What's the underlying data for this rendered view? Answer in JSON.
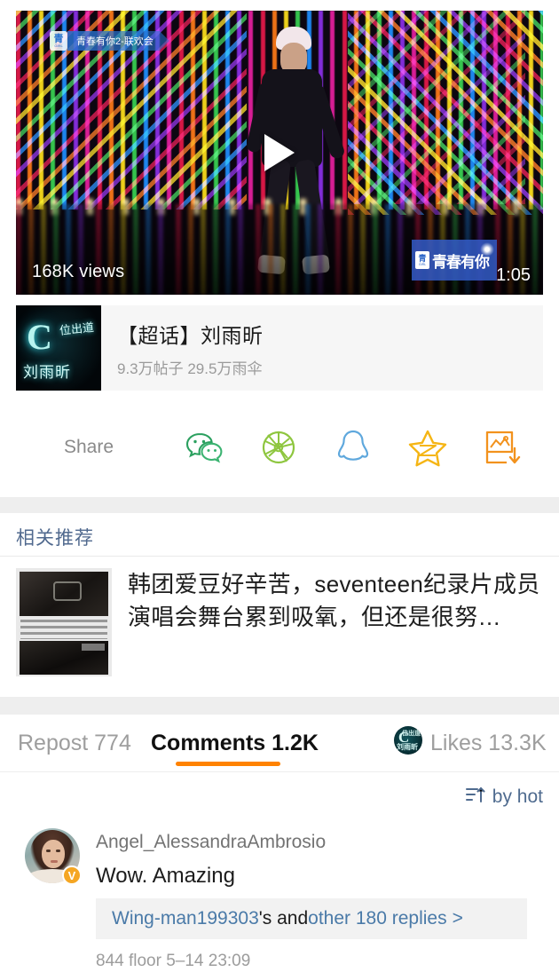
{
  "video": {
    "show_tag_label": "青春有你2-联欢会",
    "show_tag_logo": "青",
    "show_tag_logo_sub": "GIRL",
    "views": "168K views",
    "duration": "1:05",
    "watermark_cn": "青春有你",
    "watermark_logo": "青",
    "watermark_logo_sub": "GIRL",
    "play_icon": "play-icon"
  },
  "topic": {
    "thumb_c": "C",
    "thumb_line1": "位出道",
    "thumb_line2": "刘雨昕",
    "title": "【超话】刘雨昕",
    "meta": "9.3万帖子 29.5万雨伞"
  },
  "share": {
    "label": "Share",
    "icons": [
      {
        "name": "wechat-icon",
        "color": "#3fae5c"
      },
      {
        "name": "wechat-moments-icon",
        "color": "#8ec63f"
      },
      {
        "name": "qq-icon",
        "color": "#5fa8dd"
      },
      {
        "name": "favorite-star-icon",
        "color": "#f5b514"
      },
      {
        "name": "save-image-icon",
        "color": "#f2921d"
      }
    ]
  },
  "recommend": {
    "section_title": "相关推荐",
    "items": [
      {
        "text": "韩团爱豆好辛苦，seventeen纪录片成员演唱会舞台累到吸氧，但还是很努…"
      }
    ]
  },
  "tabs": {
    "repost": "Repost 774",
    "comments": "Comments 1.2K",
    "likes": "Likes 13.3K",
    "active": "comments",
    "accent_color": "#ff8200",
    "likes_avatar_c": "C",
    "likes_avatar_t": "位出道",
    "likes_avatar_b": "刘雨昕"
  },
  "sort": {
    "icon": "sort-ascending-icon",
    "label": "by hot"
  },
  "comment": {
    "username": "Angel_AlessandraAmbrosio",
    "verified_badge": "V",
    "text": "Wow.  Amazing",
    "reply_user": "Wing-man199303",
    "reply_middle": "'s and ",
    "reply_rest": "other 180 replies",
    "reply_chevron": ">",
    "footer": "844 floor 5–14 23:09"
  }
}
